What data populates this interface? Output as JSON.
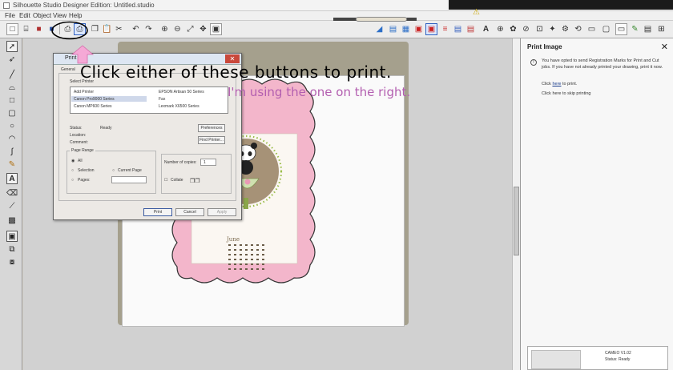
{
  "window": {
    "title": "Silhouette Studio Designer Edition: Untitled.studio"
  },
  "menu": {
    "items": [
      "File",
      "Edit",
      "Object",
      "View",
      "Help"
    ]
  },
  "toolbar": {
    "left_icons": [
      "new-icon",
      "open-icon",
      "save-icon",
      "save-as-icon",
      "print-icon",
      "print-cut-marks-icon",
      "copy-icon",
      "paste-icon",
      "cut-icon",
      "undo-icon",
      "redo-icon",
      "zoom-in-icon",
      "zoom-out-icon",
      "zoom-fit-icon",
      "pan-icon",
      "zoom-page-icon"
    ],
    "highlighted": "print-cut-marks-icon"
  },
  "annotations": {
    "main": "Click either of these buttons to print.",
    "sub": "I'm using the one on the right.",
    "main_color": "#000000",
    "sub_color": "#b35fb0"
  },
  "print_dialog": {
    "title": "Print",
    "tab": "General",
    "select_printer_label": "Select Printer",
    "printers": [
      "Add Printer",
      "Canon Pro9000 Series",
      "Canon MP600 Series",
      "EPSON Artisan 50 Series",
      "Fax",
      "Lexmark X6500 Series"
    ],
    "status_label": "Status:",
    "status_value": "Ready",
    "location_label": "Location:",
    "comment_label": "Comment:",
    "preferences_button": "Preferences",
    "find_printer_button": "Find Printer...",
    "page_range_label": "Page Range",
    "range_all": "All",
    "range_selection": "Selection",
    "range_current": "Current Page",
    "range_pages": "Pages:",
    "copies_label": "Number of copies:",
    "copies_value": "1",
    "collate_label": "Collate",
    "print_button": "Print",
    "cancel_button": "Cancel",
    "apply_button": "Apply"
  },
  "design": {
    "month": "June",
    "colors": {
      "frame": "#f3b6cb",
      "frame_edge": "#333333",
      "medallion": "#a69277",
      "dots": "#9bbd4a",
      "mat": "#a5a08d"
    }
  },
  "right_panel": {
    "title": "Print Image",
    "info_text": "You have opted to send Registration Marks for Print and Cut jobs. If you have not already printed your drawing, print it now.",
    "link_prefix": "Click ",
    "link_word": "here",
    "link_suffix": " to print.",
    "skip_text": "Click here to skip printing",
    "device_name": "CAMEO V1.02",
    "device_status": "Status: Ready"
  }
}
